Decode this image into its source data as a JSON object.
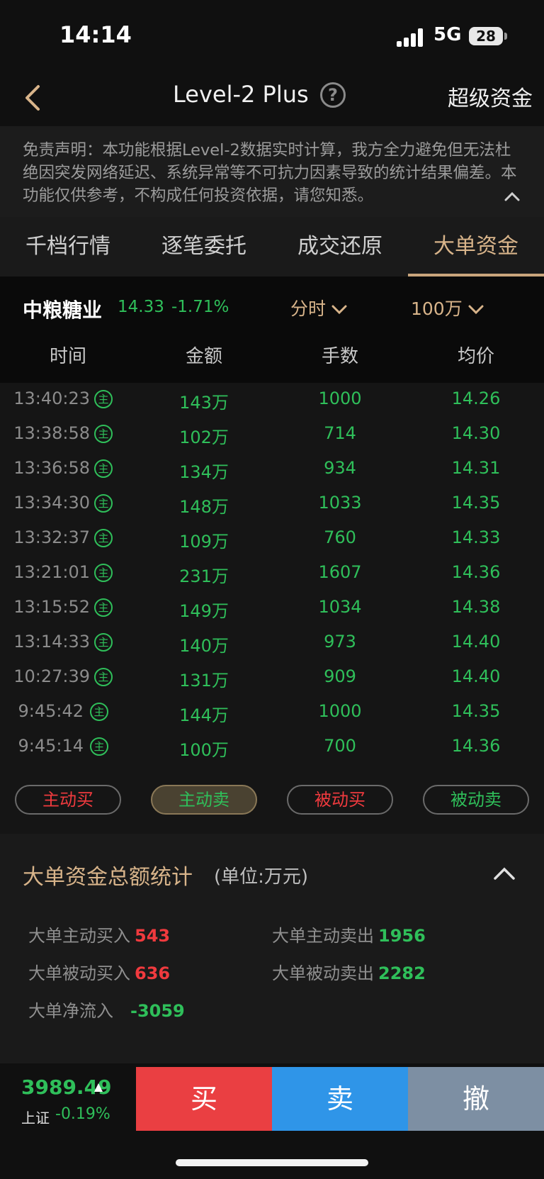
{
  "status_bar": {
    "time": "14:14",
    "network": "5G",
    "battery": "28"
  },
  "nav": {
    "title": "Level-2 Plus",
    "help": "?",
    "right_label": "超级资金"
  },
  "disclaimer": "免责声明：本功能根据Level-2数据实时计算，我方全力避免但无法杜绝因突发网络延迟、系统异常等不可抗力因素导致的统计结果偏差。本功能仅供参考，不构成任何投资依据，请您知悉。",
  "tabs": [
    "千档行情",
    "逐笔委托",
    "成交还原",
    "大单资金"
  ],
  "stock": {
    "name": "中粮糖业",
    "price": "14.33",
    "change": "-1.71%"
  },
  "filters": {
    "period": "分时",
    "threshold": "100万"
  },
  "columns": [
    "时间",
    "金额",
    "手数",
    "均价"
  ],
  "badge": "主",
  "rows": [
    {
      "time": "13:40:23",
      "amount": "143万",
      "lots": "1000",
      "avg": "14.26"
    },
    {
      "time": "13:38:58",
      "amount": "102万",
      "lots": "714",
      "avg": "14.30"
    },
    {
      "time": "13:36:58",
      "amount": "134万",
      "lots": "934",
      "avg": "14.31"
    },
    {
      "time": "13:34:30",
      "amount": "148万",
      "lots": "1033",
      "avg": "14.35"
    },
    {
      "time": "13:32:37",
      "amount": "109万",
      "lots": "760",
      "avg": "14.33"
    },
    {
      "time": "13:21:01",
      "amount": "231万",
      "lots": "1607",
      "avg": "14.36"
    },
    {
      "time": "13:15:52",
      "amount": "149万",
      "lots": "1034",
      "avg": "14.38"
    },
    {
      "time": "13:14:33",
      "amount": "140万",
      "lots": "973",
      "avg": "14.40"
    },
    {
      "time": "10:27:39",
      "amount": "131万",
      "lots": "909",
      "avg": "14.40"
    },
    {
      "time": "9:45:42",
      "amount": "144万",
      "lots": "1000",
      "avg": "14.35"
    },
    {
      "time": "9:45:14",
      "amount": "100万",
      "lots": "700",
      "avg": "14.36"
    }
  ],
  "filter_buttons": [
    "主动买",
    "主动卖",
    "被动买",
    "被动卖"
  ],
  "summary": {
    "title": "大单资金总额统计",
    "unit": "(单位:万元)",
    "active_buy_label": "大单主动买入",
    "active_buy": "543",
    "active_sell_label": "大单主动卖出",
    "active_sell": "1956",
    "passive_buy_label": "大单被动买入",
    "passive_buy": "636",
    "passive_sell_label": "大单被动卖出",
    "passive_sell": "2282",
    "net_label": "大单净流入",
    "net": "-3059"
  },
  "index": {
    "value": "3989.49",
    "name": "上证",
    "change": "-0.19%"
  },
  "actions": {
    "buy": "买",
    "sell": "卖",
    "cancel": "撤"
  },
  "colors": {
    "up": "#f03a3e",
    "down": "#2fbf5a",
    "accent": "#d8b48a",
    "buy_btn": "#ea3f42",
    "sell_btn": "#2f95e8",
    "cancel_btn": "#7d8fa3"
  }
}
